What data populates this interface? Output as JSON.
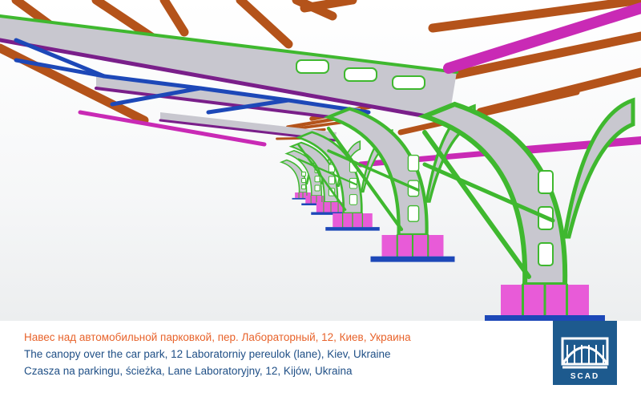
{
  "captions": [
    {
      "text": "Навес над автомобильной парковкой, пер. Лабораторный, 12, Киев, Украина",
      "color": "#e8632b"
    },
    {
      "text": "The canopy over the car park, 12 Laboratorniy pereulok (lane), Kiev, Ukraine",
      "color": "#1f4f86"
    },
    {
      "text": "Czasza na parkingu, ścieżka, Lane Laboratoryjny, 12, Kijów, Ukraina",
      "color": "#1f4f86"
    }
  ],
  "logo": {
    "text": "SCAD",
    "background": "#1d5a8e",
    "foreground": "#ffffff"
  },
  "colors": {
    "girder_web": "#c8c7cf",
    "girder_flange": "#7a1f8a",
    "purlin": "#b4531a",
    "arch_green": "#3fb82f",
    "bracing_blue": "#1d48b8",
    "base_pink": "#e85bd8",
    "base_plate": "#1d48b8",
    "rafter_magenta": "#c92ab5"
  }
}
